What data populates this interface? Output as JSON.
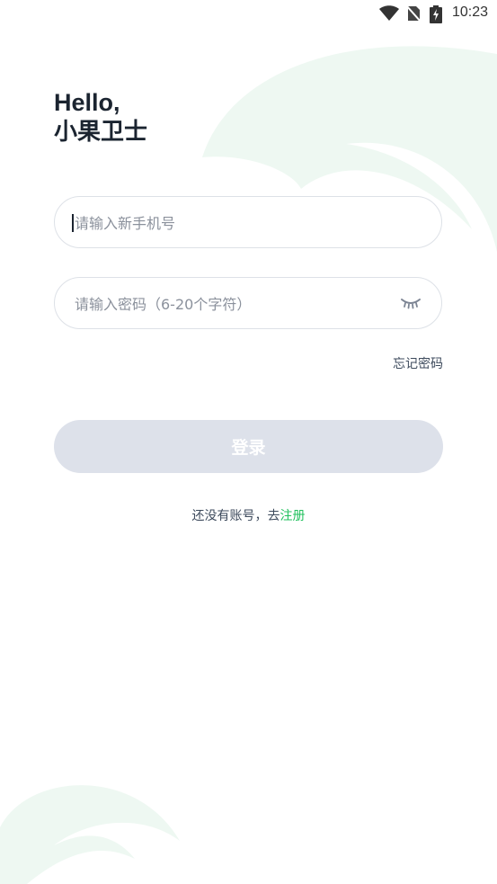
{
  "status_bar": {
    "time": "10:23",
    "icons": [
      "wifi-icon",
      "no-sim-icon",
      "battery-charging-icon"
    ]
  },
  "greeting": {
    "hello": "Hello,",
    "app_name": "小果卫士"
  },
  "phone_field": {
    "placeholder": "请输入新手机号",
    "value": ""
  },
  "password_field": {
    "placeholder": "请输入密码（6-20个字符）",
    "value": "",
    "toggle_icon": "eye-closed-icon"
  },
  "forgot_password": {
    "label": "忘记密码"
  },
  "login": {
    "label": "登录"
  },
  "register": {
    "prompt": "还没有账号，去",
    "link_label": "注册"
  },
  "colors": {
    "accent": "#22c15e",
    "button_disabled": "#dde1ea",
    "text_dark": "#1b2430",
    "text_muted": "#8b919c",
    "decoration": "#eef8f2"
  }
}
